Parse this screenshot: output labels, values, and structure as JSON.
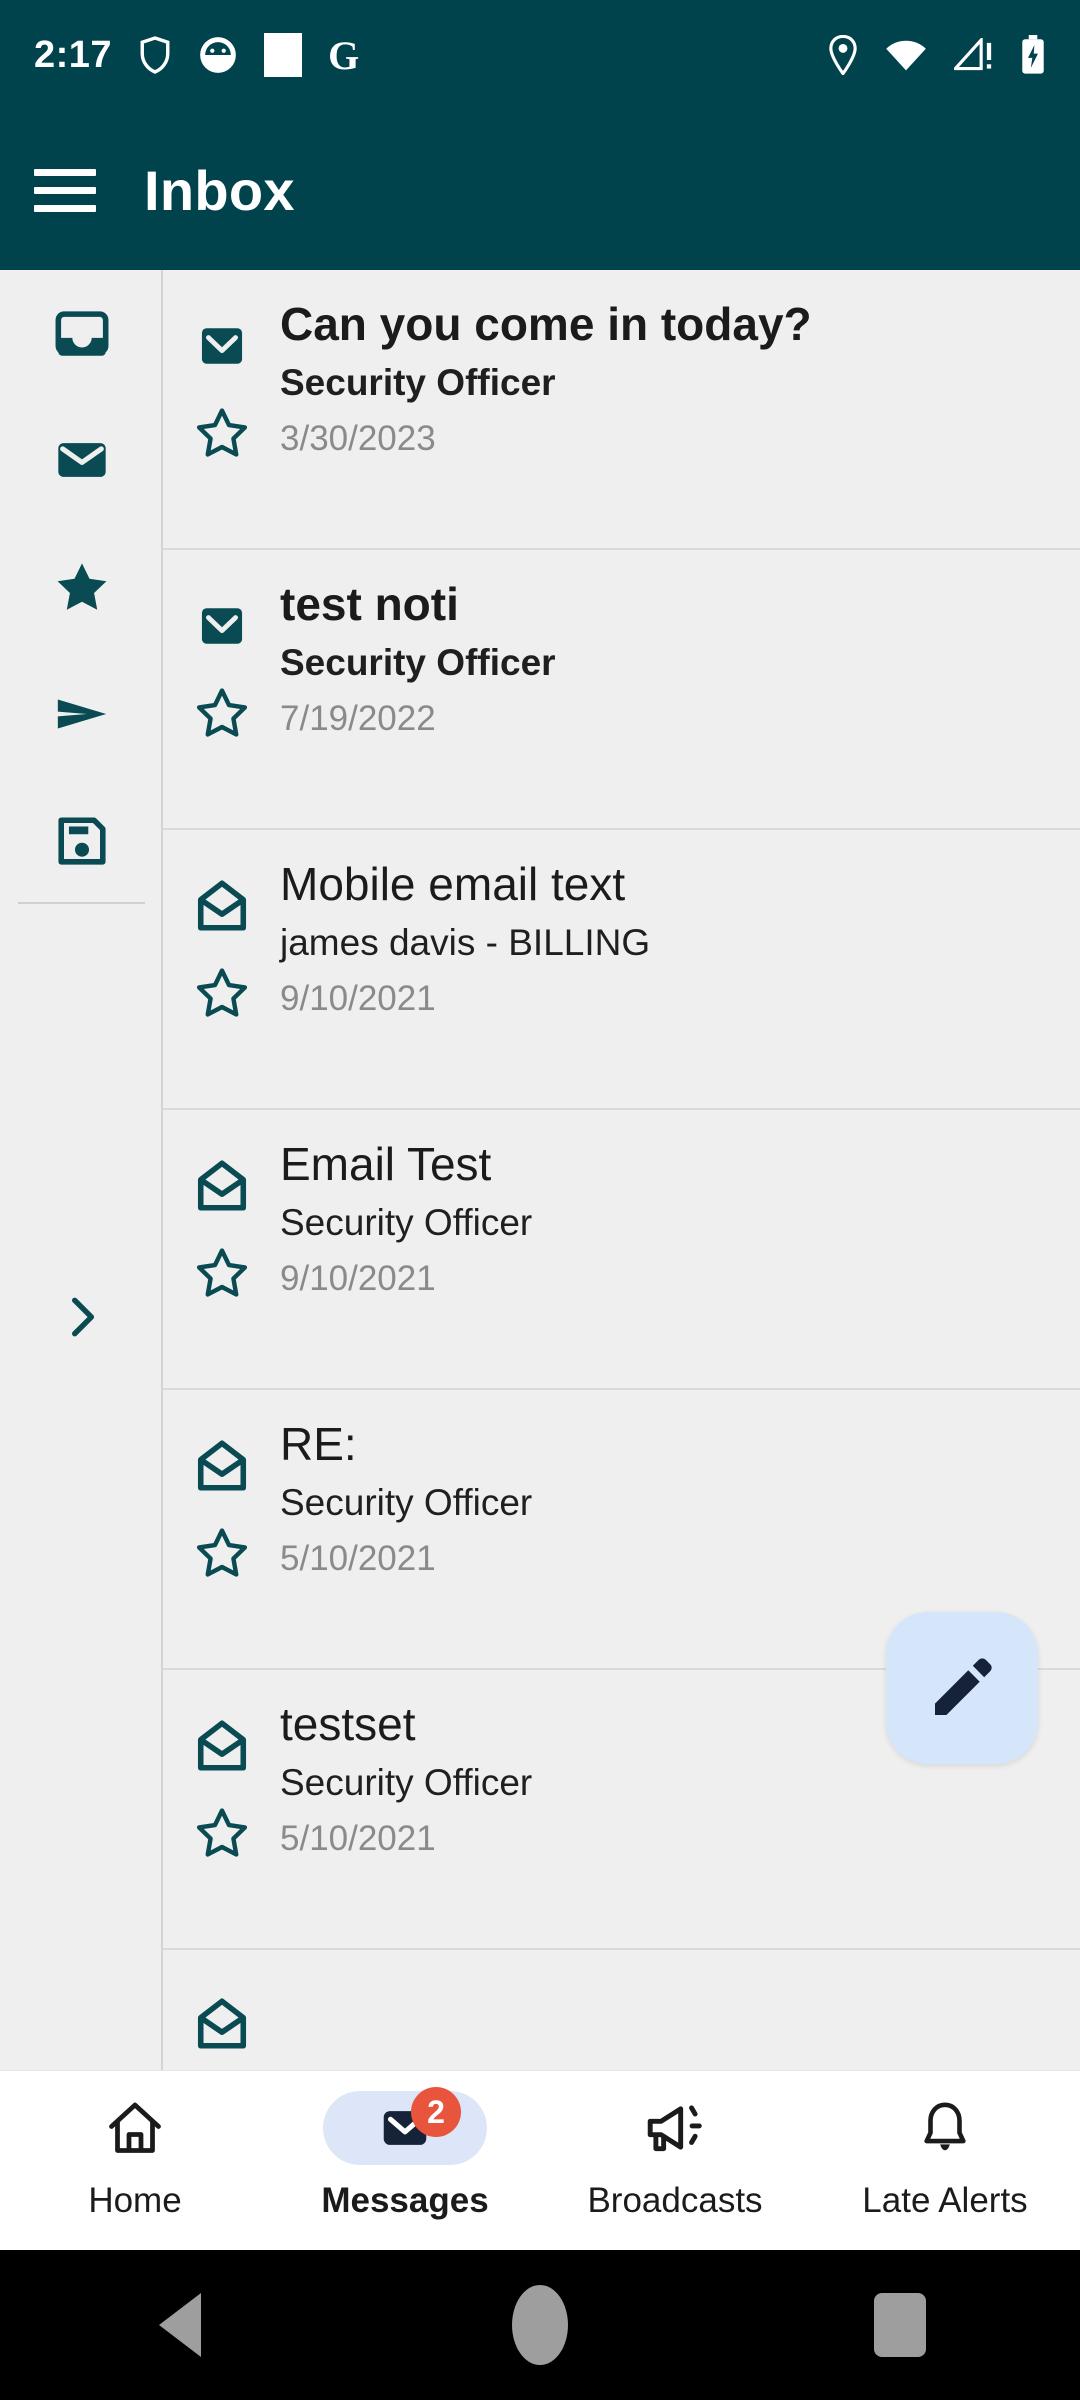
{
  "status_bar": {
    "time": "2:17",
    "left_icons": [
      "shield-icon",
      "app-circle-icon",
      "white-square-icon",
      "google-g-icon"
    ],
    "google_letter": "G",
    "right_icons": [
      "location-pin-icon",
      "wifi-icon",
      "cellular-warning-icon",
      "battery-charging-icon"
    ]
  },
  "app_bar": {
    "menu_icon": "hamburger-menu-icon",
    "title": "Inbox"
  },
  "colors": {
    "header_teal": "#00434D",
    "page_background": "#EFEFEF",
    "accent_icon": "#0A4A52",
    "fab_background": "#D6E6FA",
    "fab_icon": "#152238",
    "badge_red": "#E8553C",
    "nav_selected_pill": "#DCE6F8",
    "date_gray": "#8A8A8A"
  },
  "rail": {
    "items": [
      {
        "icon": "inbox-tray-icon",
        "name": "inbox"
      },
      {
        "icon": "envelope-filled-icon",
        "name": "unread"
      },
      {
        "icon": "star-filled-icon",
        "name": "starred"
      },
      {
        "icon": "paper-plane-icon",
        "name": "sent"
      },
      {
        "icon": "floppy-save-icon",
        "name": "drafts"
      }
    ],
    "expand_icon": "chevron-right-icon"
  },
  "mail_list": {
    "rows": [
      {
        "subject": "Can you come in today?",
        "sender": "Security Officer",
        "date": "3/30/2023",
        "unread": true,
        "envelope_icon": "envelope-closed-icon",
        "star_icon": "star-outline-icon"
      },
      {
        "subject": "test noti",
        "sender": "Security Officer",
        "date": "7/19/2022",
        "unread": true,
        "envelope_icon": "envelope-closed-icon",
        "star_icon": "star-outline-icon"
      },
      {
        "subject": "Mobile email text",
        "sender": "james davis - BILLING",
        "date": "9/10/2021",
        "unread": false,
        "envelope_icon": "envelope-open-icon",
        "star_icon": "star-outline-icon"
      },
      {
        "subject": "Email Test",
        "sender": "Security Officer",
        "date": "9/10/2021",
        "unread": false,
        "envelope_icon": "envelope-open-icon",
        "star_icon": "star-outline-icon"
      },
      {
        "subject": "RE:",
        "sender": "Security Officer",
        "date": "5/10/2021",
        "unread": false,
        "envelope_icon": "envelope-open-icon",
        "star_icon": "star-outline-icon"
      },
      {
        "subject": "testset",
        "sender": "Security Officer",
        "date": "5/10/2021",
        "unread": false,
        "envelope_icon": "envelope-open-icon",
        "star_icon": "star-outline-icon"
      },
      {
        "subject": "",
        "sender": "",
        "date": "",
        "unread": false,
        "envelope_icon": "envelope-open-icon",
        "star_icon": "star-outline-icon"
      }
    ]
  },
  "fab": {
    "icon": "pencil-compose-icon",
    "label": "Compose"
  },
  "bottom_nav": {
    "items": [
      {
        "label": "Home",
        "icon": "home-icon",
        "selected": false,
        "badge": ""
      },
      {
        "label": "Messages",
        "icon": "envelope-icon",
        "selected": true,
        "badge": "2"
      },
      {
        "label": "Broadcasts",
        "icon": "megaphone-icon",
        "selected": false,
        "badge": ""
      },
      {
        "label": "Late Alerts",
        "icon": "bell-icon",
        "selected": false,
        "badge": ""
      }
    ]
  },
  "android_nav": {
    "buttons": [
      {
        "name": "back-button",
        "icon": "triangle-back-icon"
      },
      {
        "name": "home-button",
        "icon": "circle-home-icon"
      },
      {
        "name": "recents-button",
        "icon": "square-recents-icon"
      }
    ]
  }
}
